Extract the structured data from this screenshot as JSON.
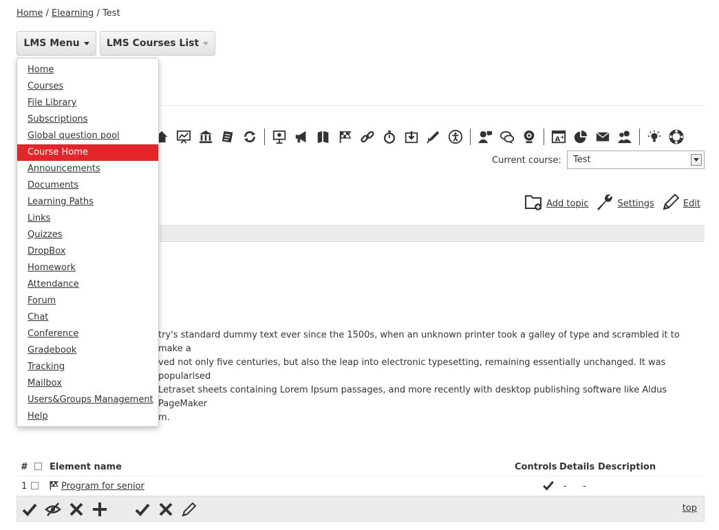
{
  "breadcrumb": [
    "Home",
    "Elearning",
    "Test"
  ],
  "buttons": {
    "lms_menu": "LMS Menu",
    "courses_list": "LMS Courses List"
  },
  "menu": {
    "items": [
      "Home",
      "Courses",
      "File Library",
      "Subscriptions",
      "Global question pool",
      "Course Home",
      "Announcements",
      "Documents",
      "Learning Paths",
      "Links",
      "Quizzes",
      "DropBox",
      "Homework",
      "Attendance",
      "Forum",
      "Chat",
      "Conference",
      "Gradebook",
      "Tracking",
      "Mailbox",
      "Users&Groups Management",
      "Help"
    ],
    "active": "Course Home"
  },
  "toolbar_icons": [
    "home-icon",
    "presentation-chart-icon",
    "bank-icon",
    "notepad-icon",
    "refresh-icon",
    "board-icon",
    "megaphone-icon",
    "books-icon",
    "checkered-flag-icon",
    "link-icon",
    "stopwatch-icon",
    "download-folder-icon",
    "pen-icon",
    "accessibility-icon",
    "user-chat-icon",
    "chat-bubbles-icon",
    "webcam-icon",
    "grade-icon",
    "pie-chart-icon",
    "mail-icon",
    "users-icon",
    "lightbulb-icon",
    "lifebuoy-icon"
  ],
  "current_course": {
    "label": "Current course:",
    "value": "Test"
  },
  "actions": {
    "add_topic": "Add topic",
    "settings": "Settings",
    "edit": "Edit"
  },
  "description": {
    "line1": "try's standard dummy text ever since the 1500s, when an unknown printer took a galley of type and scrambled it to make a",
    "line2": "ved not only five centuries, but also the leap into electronic typesetting, remaining essentially unchanged. It was popularised",
    "line3": "Letraset sheets containing Lorem Ipsum passages, and more recently with desktop publishing software like Aldus PageMaker",
    "line4": "m."
  },
  "table": {
    "headers": {
      "num": "#",
      "name": "Element name",
      "controls": "Controls",
      "details": "Details",
      "description": "Description"
    },
    "rows": [
      {
        "num": "1",
        "name": "Program for senior",
        "details": "-",
        "description": "-"
      }
    ]
  },
  "bottombar": {
    "top_link": "top"
  },
  "colors": {
    "accent": "#e4262b",
    "gray_bar": "#ebebeb"
  }
}
